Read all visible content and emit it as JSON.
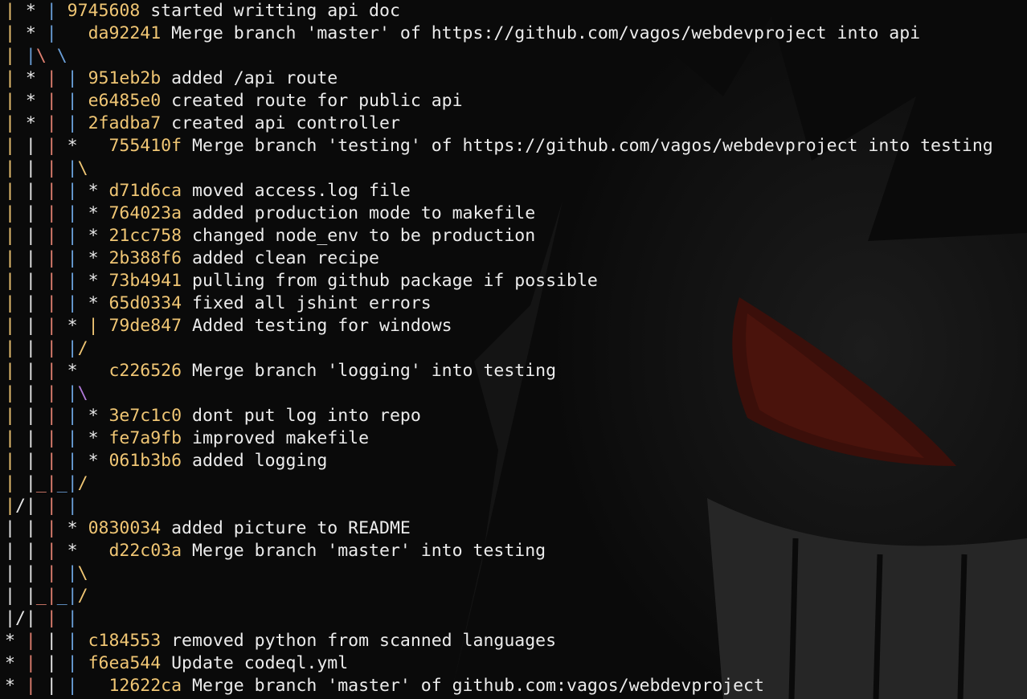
{
  "colors": {
    "background": "#0a0a0a",
    "hash": "#f0c674",
    "text": "#ececec",
    "lane_yellow": "#f0c674",
    "lane_white": "#e8e8e8",
    "lane_red": "#e08070",
    "lane_blue": "#6a9fd8",
    "lane_purple": "#b07ad8"
  },
  "graph": [
    {
      "graph": [
        [
          "| ",
          "y"
        ],
        [
          "* ",
          "w"
        ],
        [
          "| ",
          "b"
        ]
      ],
      "hash": "9745608",
      "message": "started writting api doc"
    },
    {
      "graph": [
        [
          "| ",
          "y"
        ],
        [
          "* ",
          "w"
        ],
        [
          "|   ",
          "b"
        ]
      ],
      "hash": "da92241",
      "message": "Merge branch 'master' of https://github.com/vagos/webdevproject into api"
    },
    {
      "graph": [
        [
          "| ",
          "y"
        ],
        [
          "|",
          "b"
        ],
        [
          "\\ ",
          "r"
        ],
        [
          "\\",
          "b"
        ]
      ],
      "hash": "",
      "message": ""
    },
    {
      "graph": [
        [
          "| ",
          "y"
        ],
        [
          "* ",
          "w"
        ],
        [
          "| ",
          "r"
        ],
        [
          "| ",
          "b"
        ]
      ],
      "hash": "951eb2b",
      "message": "added /api route"
    },
    {
      "graph": [
        [
          "| ",
          "y"
        ],
        [
          "* ",
          "w"
        ],
        [
          "| ",
          "r"
        ],
        [
          "| ",
          "b"
        ]
      ],
      "hash": "e6485e0",
      "message": "created route for public api"
    },
    {
      "graph": [
        [
          "| ",
          "y"
        ],
        [
          "* ",
          "w"
        ],
        [
          "| ",
          "r"
        ],
        [
          "| ",
          "b"
        ]
      ],
      "hash": "2fadba7",
      "message": "created api controller"
    },
    {
      "graph": [
        [
          "| ",
          "y"
        ],
        [
          "| ",
          "w"
        ],
        [
          "| ",
          "r"
        ],
        [
          "*   ",
          "w"
        ]
      ],
      "hash": "755410f",
      "message": "Merge branch 'testing' of https://github.com/vagos/webdevproject into testing"
    },
    {
      "graph": [
        [
          "| ",
          "y"
        ],
        [
          "| ",
          "w"
        ],
        [
          "| ",
          "r"
        ],
        [
          "|",
          "b"
        ],
        [
          "\\",
          "y"
        ]
      ],
      "hash": "",
      "message": ""
    },
    {
      "graph": [
        [
          "| ",
          "y"
        ],
        [
          "| ",
          "w"
        ],
        [
          "| ",
          "r"
        ],
        [
          "| ",
          "b"
        ],
        [
          "* ",
          "w"
        ]
      ],
      "hash": "d71d6ca",
      "message": "moved access.log file"
    },
    {
      "graph": [
        [
          "| ",
          "y"
        ],
        [
          "| ",
          "w"
        ],
        [
          "| ",
          "r"
        ],
        [
          "| ",
          "b"
        ],
        [
          "* ",
          "w"
        ]
      ],
      "hash": "764023a",
      "message": "added production mode to makefile"
    },
    {
      "graph": [
        [
          "| ",
          "y"
        ],
        [
          "| ",
          "w"
        ],
        [
          "| ",
          "r"
        ],
        [
          "| ",
          "b"
        ],
        [
          "* ",
          "w"
        ]
      ],
      "hash": "21cc758",
      "message": "changed node_env to be production"
    },
    {
      "graph": [
        [
          "| ",
          "y"
        ],
        [
          "| ",
          "w"
        ],
        [
          "| ",
          "r"
        ],
        [
          "| ",
          "b"
        ],
        [
          "* ",
          "w"
        ]
      ],
      "hash": "2b388f6",
      "message": "added clean recipe"
    },
    {
      "graph": [
        [
          "| ",
          "y"
        ],
        [
          "| ",
          "w"
        ],
        [
          "| ",
          "r"
        ],
        [
          "| ",
          "b"
        ],
        [
          "* ",
          "w"
        ]
      ],
      "hash": "73b4941",
      "message": "pulling from github package if possible"
    },
    {
      "graph": [
        [
          "| ",
          "y"
        ],
        [
          "| ",
          "w"
        ],
        [
          "| ",
          "r"
        ],
        [
          "| ",
          "b"
        ],
        [
          "* ",
          "w"
        ]
      ],
      "hash": "65d0334",
      "message": "fixed all jshint errors"
    },
    {
      "graph": [
        [
          "| ",
          "y"
        ],
        [
          "| ",
          "w"
        ],
        [
          "| ",
          "r"
        ],
        [
          "* ",
          "w"
        ],
        [
          "| ",
          "y"
        ]
      ],
      "hash": "79de847",
      "message": "Added testing for windows"
    },
    {
      "graph": [
        [
          "| ",
          "y"
        ],
        [
          "| ",
          "w"
        ],
        [
          "| ",
          "r"
        ],
        [
          "|",
          "b"
        ],
        [
          "/",
          "y"
        ]
      ],
      "hash": "",
      "message": ""
    },
    {
      "graph": [
        [
          "| ",
          "y"
        ],
        [
          "| ",
          "w"
        ],
        [
          "| ",
          "r"
        ],
        [
          "*   ",
          "w"
        ]
      ],
      "hash": "c226526",
      "message": "Merge branch 'logging' into testing"
    },
    {
      "graph": [
        [
          "| ",
          "y"
        ],
        [
          "| ",
          "w"
        ],
        [
          "| ",
          "r"
        ],
        [
          "|",
          "b"
        ],
        [
          "\\",
          "p"
        ]
      ],
      "hash": "",
      "message": ""
    },
    {
      "graph": [
        [
          "| ",
          "y"
        ],
        [
          "| ",
          "w"
        ],
        [
          "| ",
          "r"
        ],
        [
          "| ",
          "b"
        ],
        [
          "* ",
          "w"
        ]
      ],
      "hash": "3e7c1c0",
      "message": "dont put log into repo"
    },
    {
      "graph": [
        [
          "| ",
          "y"
        ],
        [
          "| ",
          "w"
        ],
        [
          "| ",
          "r"
        ],
        [
          "| ",
          "b"
        ],
        [
          "* ",
          "w"
        ]
      ],
      "hash": "fe7a9fb",
      "message": "improved makefile"
    },
    {
      "graph": [
        [
          "| ",
          "y"
        ],
        [
          "| ",
          "w"
        ],
        [
          "| ",
          "r"
        ],
        [
          "| ",
          "b"
        ],
        [
          "* ",
          "w"
        ]
      ],
      "hash": "061b3b6",
      "message": "added logging"
    },
    {
      "graph": [
        [
          "| ",
          "y"
        ],
        [
          "|",
          "w"
        ],
        [
          "_",
          "r"
        ],
        [
          "|",
          "r"
        ],
        [
          "_",
          "b"
        ],
        [
          "|",
          "b"
        ],
        [
          "/",
          "y"
        ]
      ],
      "hash": "",
      "message": ""
    },
    {
      "graph": [
        [
          "|",
          "y"
        ],
        [
          "/",
          "w"
        ],
        [
          "| ",
          "w"
        ],
        [
          "| ",
          "r"
        ],
        [
          "| ",
          "b"
        ]
      ],
      "hash": "",
      "message": ""
    },
    {
      "graph": [
        [
          "| ",
          "w"
        ],
        [
          "| ",
          "w"
        ],
        [
          "| ",
          "r"
        ],
        [
          "* ",
          "w"
        ]
      ],
      "hash": "0830034",
      "message": "added picture to README"
    },
    {
      "graph": [
        [
          "| ",
          "w"
        ],
        [
          "| ",
          "w"
        ],
        [
          "| ",
          "r"
        ],
        [
          "*   ",
          "w"
        ]
      ],
      "hash": "d22c03a",
      "message": "Merge branch 'master' into testing"
    },
    {
      "graph": [
        [
          "| ",
          "w"
        ],
        [
          "| ",
          "w"
        ],
        [
          "| ",
          "r"
        ],
        [
          "|",
          "b"
        ],
        [
          "\\",
          "y"
        ]
      ],
      "hash": "",
      "message": ""
    },
    {
      "graph": [
        [
          "| ",
          "w"
        ],
        [
          "|",
          "w"
        ],
        [
          "_",
          "r"
        ],
        [
          "|",
          "r"
        ],
        [
          "_",
          "b"
        ],
        [
          "|",
          "b"
        ],
        [
          "/",
          "y"
        ]
      ],
      "hash": "",
      "message": ""
    },
    {
      "graph": [
        [
          "|",
          "w"
        ],
        [
          "/",
          "w"
        ],
        [
          "| ",
          "w"
        ],
        [
          "| ",
          "r"
        ],
        [
          "| ",
          "b"
        ]
      ],
      "hash": "",
      "message": ""
    },
    {
      "graph": [
        [
          "* ",
          "w"
        ],
        [
          "| ",
          "r"
        ],
        [
          "| ",
          "w"
        ],
        [
          "| ",
          "b"
        ]
      ],
      "hash": "c184553",
      "message": "removed python from scanned languages"
    },
    {
      "graph": [
        [
          "* ",
          "w"
        ],
        [
          "| ",
          "r"
        ],
        [
          "| ",
          "w"
        ],
        [
          "| ",
          "b"
        ]
      ],
      "hash": "f6ea544",
      "message": "Update codeql.yml"
    },
    {
      "graph": [
        [
          "* ",
          "w"
        ],
        [
          "| ",
          "r"
        ],
        [
          "| ",
          "w"
        ],
        [
          "|   ",
          "b"
        ]
      ],
      "hash": "12622ca",
      "message": "Merge branch 'master' of github.com:vagos/webdevproject"
    }
  ]
}
